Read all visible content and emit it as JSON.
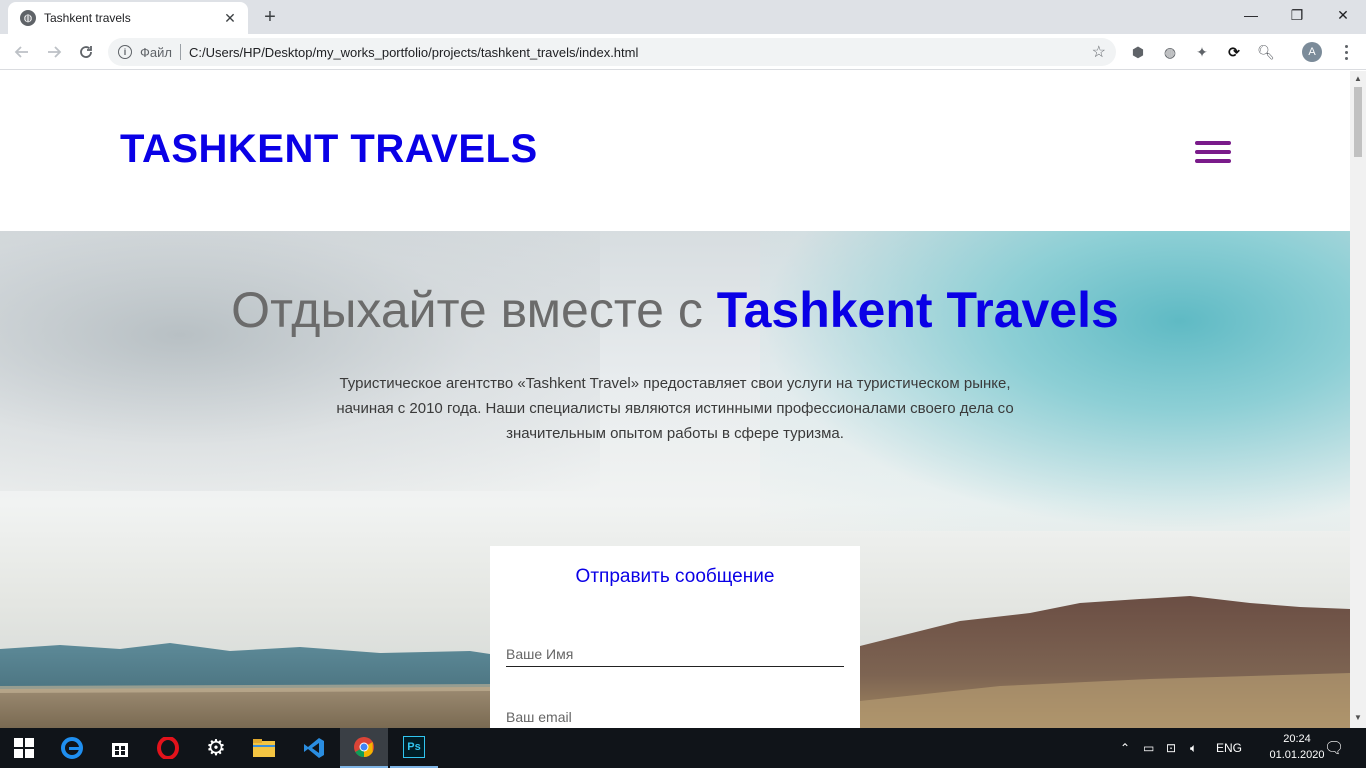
{
  "browser": {
    "tab_title": "Tashkent travels",
    "new_tab": "+",
    "protocol_label": "Файл",
    "url": "C:/Users/HP/Desktop/my_works_portfolio/projects/tashkent_travels/index.html",
    "avatar_letter": "A",
    "window_controls": {
      "minimize": "—",
      "restore": "❐",
      "close": "✕"
    }
  },
  "site": {
    "logo": "TASHKENT TRAVELS",
    "hero": {
      "title_prefix": "Отдыхайте вместе с",
      "title_brand": "Tashkent Travels",
      "description": "Туристическое агентство «Tashkent Travel» предоставляет свои услуги на туристическом рынке, начиная с 2010 года. Наши специалисты являются истинными профессионалами своего дела со значительным опытом работы в сфере туризма."
    },
    "form": {
      "title": "Отправить сообщение",
      "name_placeholder": "Ваше Имя",
      "email_placeholder": "Ваш email"
    }
  },
  "taskbar": {
    "tray_language": "ENG",
    "time": "20:24",
    "date": "01.01.2020"
  },
  "colors": {
    "brand": "#0a00e6",
    "burger": "#7a1b8a"
  }
}
